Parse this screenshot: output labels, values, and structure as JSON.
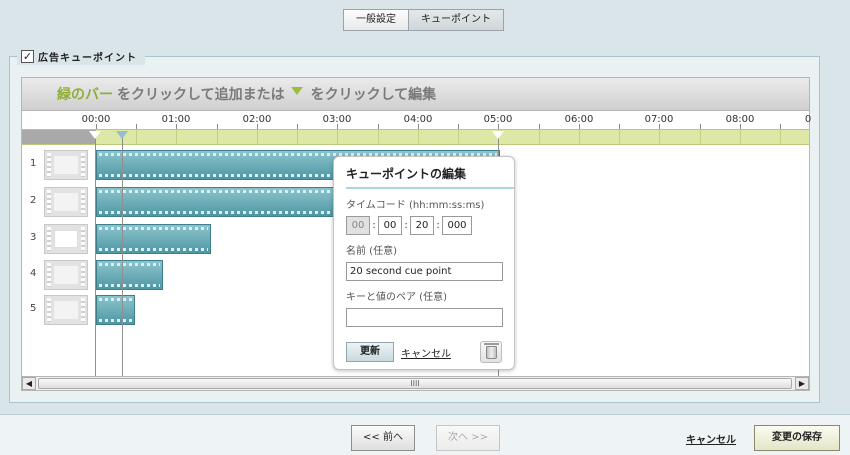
{
  "tabs": [
    {
      "label": "一般設定",
      "active": false
    },
    {
      "label": "キューポイント",
      "active": true
    }
  ],
  "section": {
    "checkbox_checked": true,
    "check_mark": "✓",
    "label": "広告キューポイント"
  },
  "instruction": {
    "part1": "緑のバー",
    "part2": "をクリックして追加または",
    "part3": "をクリックして編集"
  },
  "ruler": {
    "ticks": [
      "00:00",
      "01:00",
      "02:00",
      "03:00",
      "04:00",
      "05:00",
      "06:00",
      "07:00",
      "08:00",
      "0"
    ]
  },
  "tracks": [
    {
      "number": "1"
    },
    {
      "number": "2"
    },
    {
      "number": "3"
    },
    {
      "number": "4"
    },
    {
      "number": "5"
    }
  ],
  "scrollbar": {
    "left_arrow": "◀",
    "right_arrow": "▶",
    "grip": "IIII"
  },
  "popup": {
    "title": "キューポイントの編集",
    "timecode_label": "タイムコード (hh:mm:ss:ms)",
    "timecode": {
      "hh": "00",
      "mm": "00",
      "ss": "20",
      "ms": "000"
    },
    "name_label": "名前 (任意)",
    "name_value": "20 second cue point",
    "kv_label": "キーと値のペア (任意)",
    "kv_value": "",
    "update_button": "更新",
    "cancel_link": "キャンセル"
  },
  "footer": {
    "prev_button": "<< 前へ",
    "next_button": "次へ >>",
    "cancel_link": "キャンセル",
    "save_button": "変更の保存"
  },
  "colors": {
    "accent_green": "#8fae3a",
    "clip_teal": "#4f97a3",
    "cue_bar": "#dde8a6"
  }
}
